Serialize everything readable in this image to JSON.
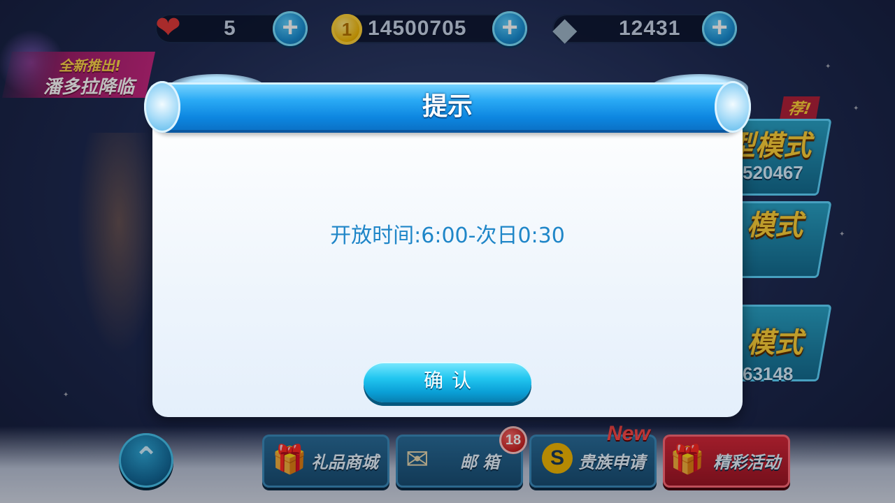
{
  "resources": {
    "hearts": "5",
    "coins": "14500705",
    "diamonds": "12431",
    "plus_glyph": "+",
    "heart_glyph": "❤",
    "coin_glyph": "1",
    "diamond_glyph": "◆"
  },
  "promo": {
    "line1": "全新推出!",
    "line2": "潘多拉降临"
  },
  "modes": {
    "recommend_label": "荐!",
    "mode1_label": "型模式",
    "mode1_num": "520467",
    "mode2_label": "模式",
    "mode3_label": "模式",
    "mode3_num": "63148"
  },
  "bottom": {
    "up_glyph": "⌃",
    "gift_shop": "礼品商城",
    "mail": "邮 箱",
    "mail_badge": "18",
    "noble": "贵族申请",
    "new_tag": "New",
    "events": "精彩活动",
    "gift_icon_glyph": "🎁",
    "mail_icon_glyph": "✉",
    "noble_icon_glyph": "S"
  },
  "dialog": {
    "title": "提示",
    "message": "开放时间:6:00-次日0:30",
    "confirm_label": "确认"
  },
  "colors": {
    "dialog_message": "#1f86c8",
    "header_blue": "#0d86e0",
    "confirm_cyan": "#22c6f0"
  }
}
